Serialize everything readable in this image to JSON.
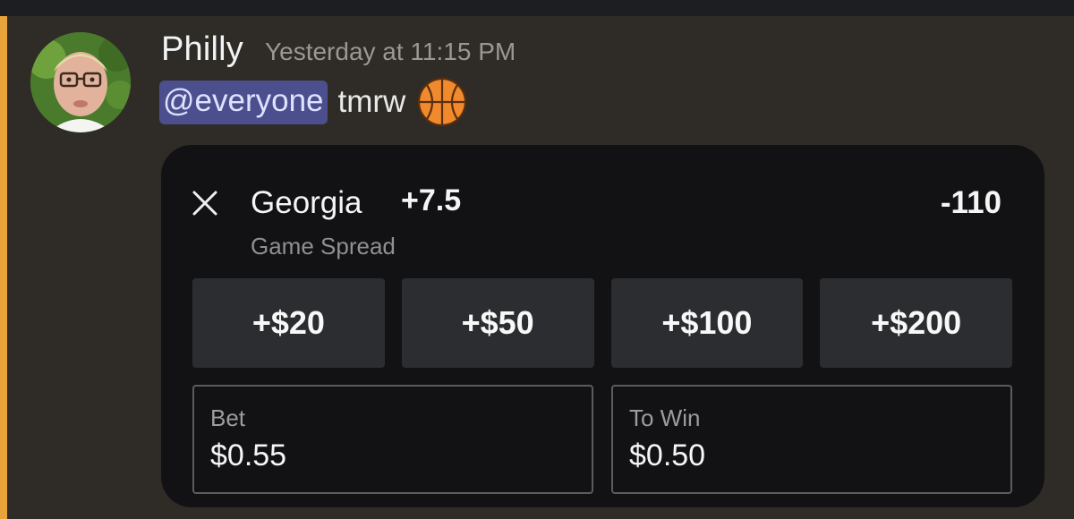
{
  "message": {
    "username": "Philly",
    "timestamp": "Yesterday at 11:15 PM",
    "mention": "@everyone",
    "text": "tmrw",
    "emoji": "basketball-icon",
    "avatar": "user-avatar-photo"
  },
  "bet_slip": {
    "team": "Georgia",
    "spread": "+7.5",
    "odds": "-110",
    "market": "Game Spread",
    "close_icon": "close-icon",
    "quick_amounts": [
      "+$20",
      "+$50",
      "+$100",
      "+$200"
    ],
    "bet_label": "Bet",
    "bet_value": "$0.55",
    "to_win_label": "To Win",
    "to_win_value": "$0.50"
  },
  "colors": {
    "background": "#2f2c27",
    "mention_stripe": "#e8a33b",
    "mention_bg": "#4b4f8e",
    "card_bg": "#121214",
    "quick_button_bg": "#2b2d30"
  }
}
